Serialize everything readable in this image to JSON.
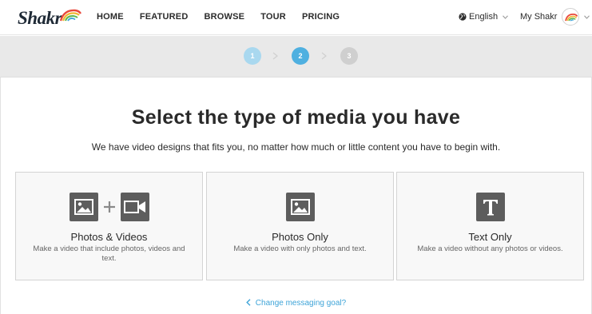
{
  "header": {
    "logo_text": "Shakr",
    "nav": [
      "HOME",
      "FEATURED",
      "BROWSE",
      "TOUR",
      "PRICING"
    ],
    "language": "English",
    "account_label": "My Shakr"
  },
  "steps": [
    "1",
    "2",
    "3"
  ],
  "main": {
    "title": "Select the type of media you have",
    "subtitle": "We have video designs that fits you, no matter how much or little content you have to begin with."
  },
  "cards": [
    {
      "title": "Photos & Videos",
      "description": "Make a video that include photos, videos and text."
    },
    {
      "title": "Photos Only",
      "description": "Make a video with only photos and text."
    },
    {
      "title": "Text Only",
      "description": "Make a video without any photos or videos."
    }
  ],
  "footer": {
    "change_goal": "Change messaging goal?"
  },
  "colors": {
    "accent": "#4fb0e0",
    "link": "#3ea4d8",
    "icon": "#5d5d5d",
    "step_done": "#a9d8ef",
    "step_todo": "#cfcfcf"
  }
}
